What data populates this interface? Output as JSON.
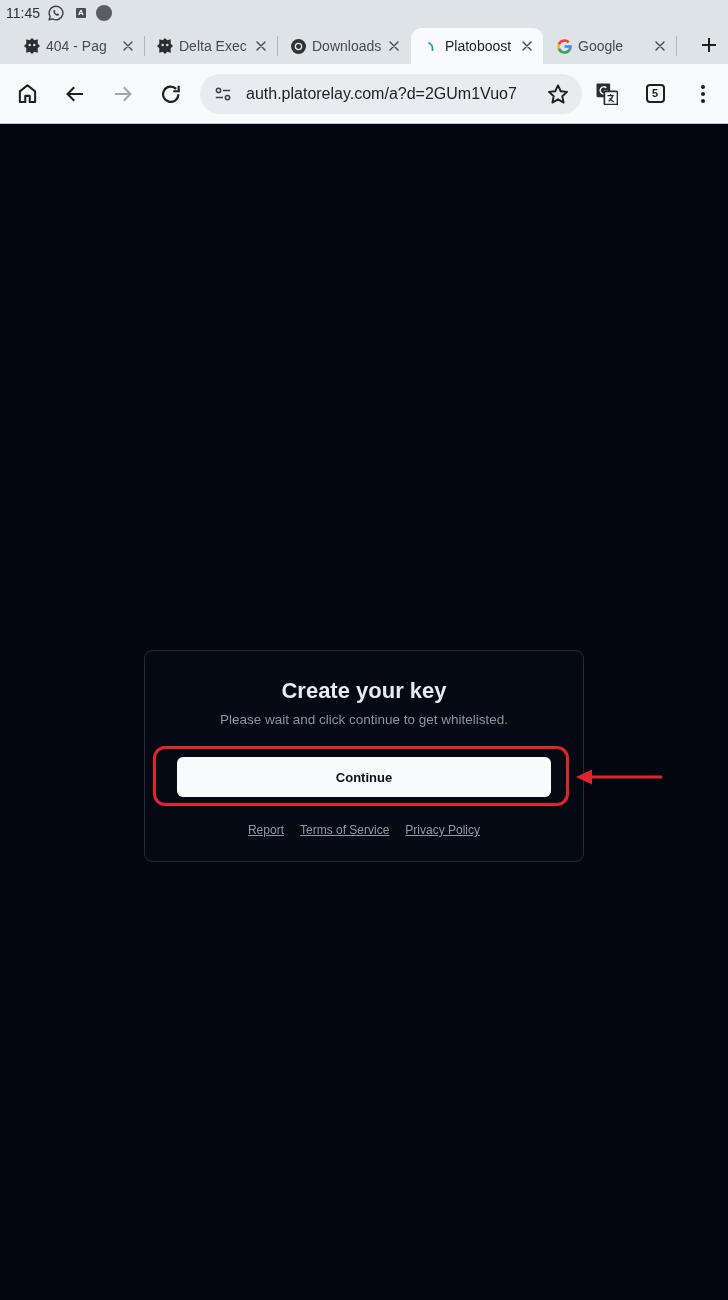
{
  "status_bar": {
    "time": "11:45",
    "icons": [
      {
        "kind": "whatsapp"
      },
      {
        "kind": "letter",
        "label": "A"
      },
      {
        "kind": "dot"
      }
    ]
  },
  "tabs": [
    {
      "title": "404 - Pag",
      "kind": "emblem",
      "selected": false
    },
    {
      "title": "Delta Exec",
      "kind": "emblem",
      "selected": false
    },
    {
      "title": "Downloads",
      "kind": "ring",
      "selected": false
    },
    {
      "title": "Platoboost",
      "kind": "spinner",
      "selected": true
    },
    {
      "title": "Google",
      "kind": "multicolor",
      "selected": false
    }
  ],
  "toolbar": {
    "back": {
      "disabled": false
    },
    "forward": {
      "disabled": true
    },
    "url": "auth.platorelay.com/a?d=2GUm1Vuo7",
    "bookmarked": false,
    "tab_count": "5"
  },
  "card": {
    "title": "Create your key",
    "subtitle": "Please wait and click continue to get whitelisted.",
    "button": {
      "label": "Continue",
      "highlighted": true
    },
    "links": [
      "Report",
      "Terms of Service",
      "Privacy Policy"
    ]
  }
}
